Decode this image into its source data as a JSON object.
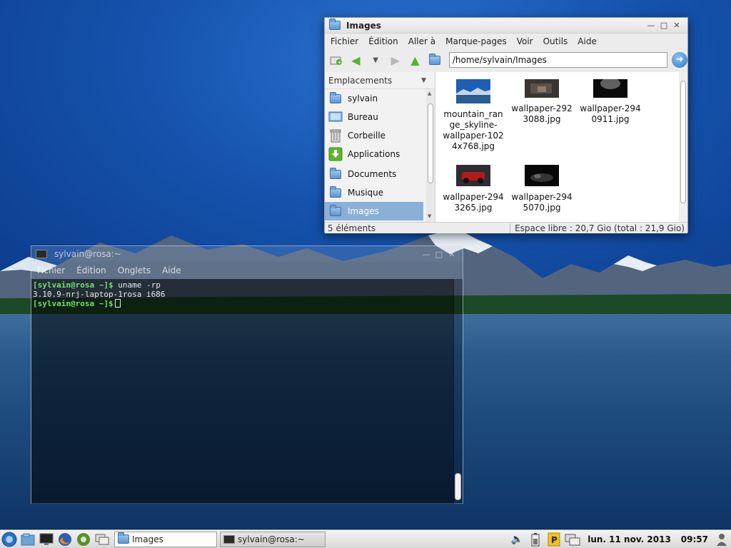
{
  "file_manager": {
    "title": "Images",
    "menus": [
      "Fichier",
      "Édition",
      "Aller à",
      "Marque-pages",
      "Voir",
      "Outils",
      "Aide"
    ],
    "path": "/home/sylvain/Images",
    "side_header": "Emplacements",
    "places": [
      {
        "label": "sylvain",
        "icon": "home-folder-icon"
      },
      {
        "label": "Bureau",
        "icon": "desktop-icon"
      },
      {
        "label": "Corbeille",
        "icon": "trash-icon"
      },
      {
        "label": "Applications",
        "icon": "applications-icon"
      },
      {
        "label": "Documents",
        "icon": "folder-icon"
      },
      {
        "label": "Musique",
        "icon": "folder-icon"
      },
      {
        "label": "Images",
        "icon": "folder-icon"
      }
    ],
    "selected_place": "Images",
    "files": [
      {
        "name": "mountain_range_skyline-wallpaper-1024x768.jpg",
        "lines": [
          "mountain_ran",
          "ge_skyline-",
          "wallpaper-102",
          "4x768.jpg"
        ]
      },
      {
        "name": "wallpaper-2923088.jpg",
        "lines": [
          "wallpaper-292",
          "3088.jpg"
        ]
      },
      {
        "name": "wallpaper-2940911.jpg",
        "lines": [
          "wallpaper-294",
          "0911.jpg"
        ]
      },
      {
        "name": "wallpaper-2943265.jpg",
        "lines": [
          "wallpaper-294",
          "3265.jpg"
        ]
      },
      {
        "name": "wallpaper-2945070.jpg",
        "lines": [
          "wallpaper-294",
          "5070.jpg"
        ]
      }
    ],
    "status_count": "5 éléments",
    "status_free": "Espace libre : 20,7 Gio (total : 21,9 Gio)"
  },
  "terminal": {
    "title": "sylvain@rosa:~",
    "menus": [
      "Fichier",
      "Édition",
      "Onglets",
      "Aide"
    ],
    "lines": [
      {
        "prompt": "[sylvain@rosa ~]$",
        "text": " uname -rp"
      },
      {
        "prompt": "",
        "text": "3.10.9-nrj-laptop-1rosa i686"
      },
      {
        "prompt": "[sylvain@rosa ~]$",
        "text": ""
      }
    ]
  },
  "taskbar": {
    "tasks": [
      {
        "label": "Images",
        "state": "active"
      },
      {
        "label": "sylvain@rosa:~",
        "state": "inactive"
      }
    ],
    "date": "lun. 11 nov. 2013",
    "time": "09:57"
  },
  "colors": {
    "prompt": "#6fe06b",
    "selection": "#8ab0d8",
    "accent_green": "#57b12c"
  }
}
